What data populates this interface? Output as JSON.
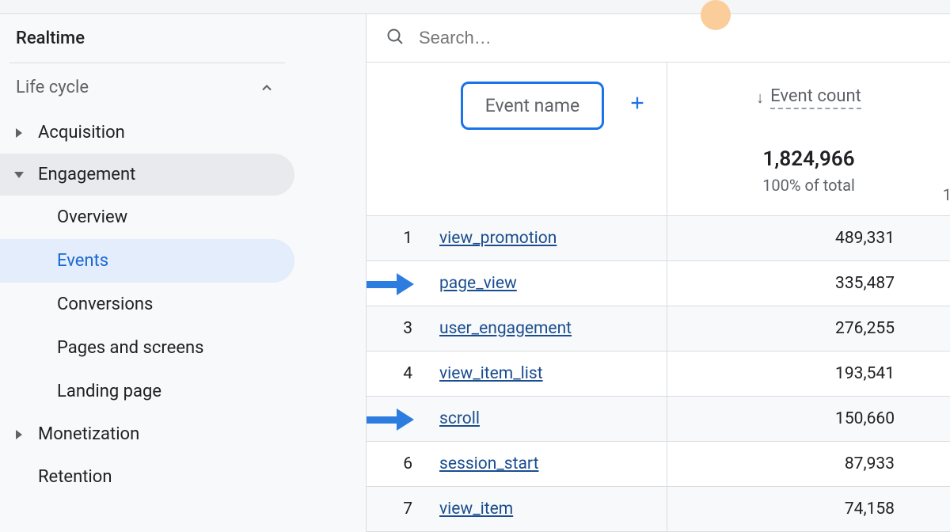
{
  "sidebar": {
    "realtime": "Realtime",
    "life_cycle": "Life cycle",
    "acquisition": "Acquisition",
    "engagement": "Engagement",
    "sub": {
      "overview": "Overview",
      "events": "Events",
      "conversions": "Conversions",
      "pages_screens": "Pages and screens",
      "landing_page": "Landing page"
    },
    "monetization": "Monetization",
    "retention": "Retention"
  },
  "search": {
    "placeholder": "Search…"
  },
  "header": {
    "event_name": "Event name",
    "event_count": "Event count"
  },
  "totals": {
    "value": "1,824,966",
    "subtext": "100% of total"
  },
  "rows": [
    {
      "idx": "1",
      "name": "view_promotion",
      "count": "489,331"
    },
    {
      "idx": "",
      "name": "page_view",
      "count": "335,487"
    },
    {
      "idx": "3",
      "name": "user_engagement",
      "count": "276,255"
    },
    {
      "idx": "4",
      "name": "view_item_list",
      "count": "193,541"
    },
    {
      "idx": "",
      "name": "scroll",
      "count": "150,660"
    },
    {
      "idx": "6",
      "name": "session_start",
      "count": "87,933"
    },
    {
      "idx": "7",
      "name": "view_item",
      "count": "74,158"
    }
  ],
  "far_right": "1"
}
